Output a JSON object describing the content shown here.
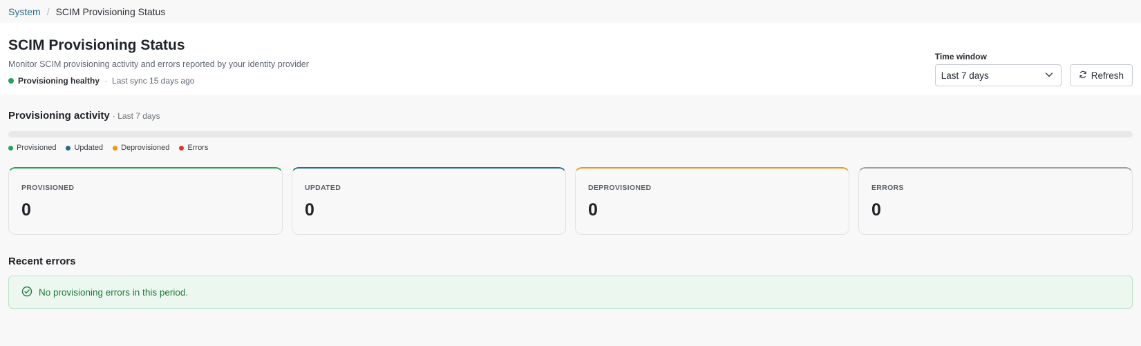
{
  "breadcrumb": {
    "parent": "System",
    "separator": "/",
    "current": "SCIM Provisioning Status"
  },
  "header": {
    "title": "SCIM Provisioning Status",
    "subtitle": "Monitor SCIM provisioning activity and errors reported by your identity provider",
    "status": {
      "label": "Provisioning healthy",
      "separator": "·",
      "last_sync": "Last sync 15 days ago",
      "color": "#22a35a"
    }
  },
  "controls": {
    "time_window_label": "Time window",
    "time_window_value": "Last 7 days",
    "refresh_label": "Refresh"
  },
  "activity": {
    "title": "Provisioning activity",
    "range": "· Last 7 days",
    "legend": [
      {
        "label": "Provisioned",
        "color": "#22a35a"
      },
      {
        "label": "Updated",
        "color": "#1f6f8b"
      },
      {
        "label": "Deprovisioned",
        "color": "#f0960f"
      },
      {
        "label": "Errors",
        "color": "#e0372c"
      }
    ]
  },
  "cards": [
    {
      "label": "PROVISIONED",
      "value": "0",
      "accent": "#22a35a"
    },
    {
      "label": "UPDATED",
      "value": "0",
      "accent": "#1f6f8b"
    },
    {
      "label": "DEPROVISIONED",
      "value": "0",
      "accent": "#f0960f"
    },
    {
      "label": "ERRORS",
      "value": "0",
      "accent": "#9aa0a6"
    }
  ],
  "recent_errors": {
    "title": "Recent errors",
    "empty_message": "No provisioning errors in this period.",
    "color": "#1e7a3c"
  }
}
